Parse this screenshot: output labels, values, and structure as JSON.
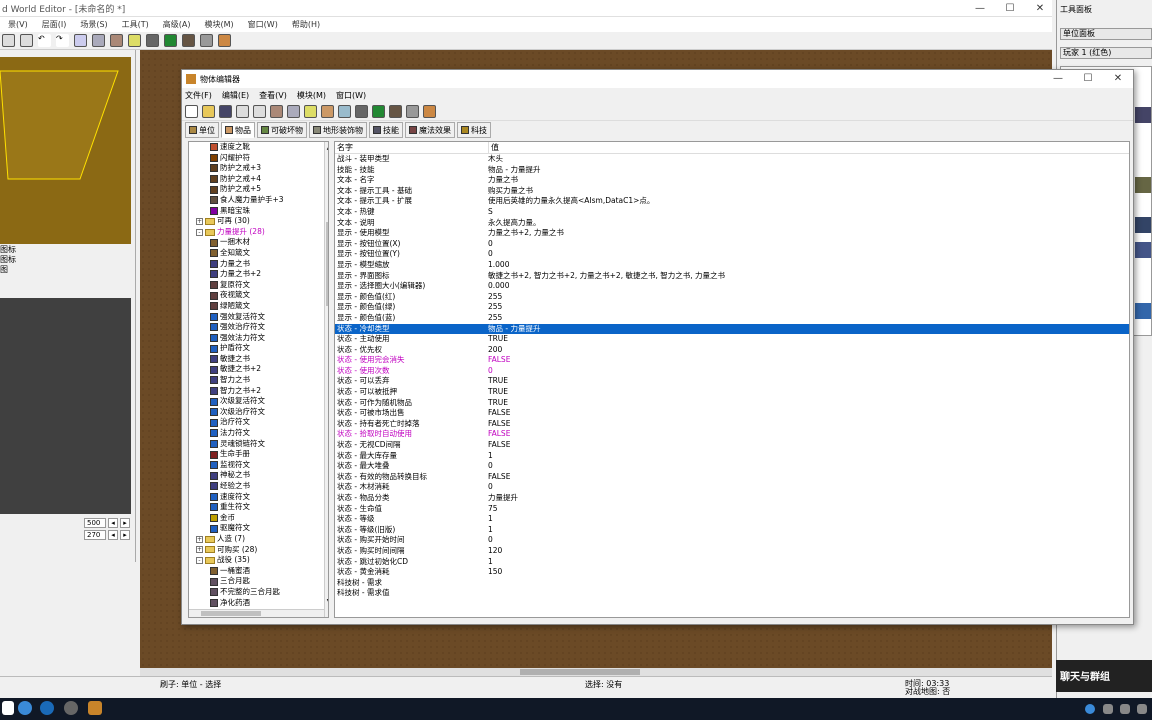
{
  "we": {
    "title": "d World Editor - [未命名的 *]",
    "menu": [
      "景(V)",
      "层面(I)",
      "场景(S)",
      "工具(T)",
      "高级(A)",
      "模块(M)",
      "窗口(W)",
      "帮助(H)"
    ],
    "left_labels": [
      "图标",
      "图标",
      "图"
    ],
    "left_values": [
      "500",
      "270"
    ]
  },
  "right_panel": {
    "title": "工具面板",
    "sel1": "单位面板",
    "sel2": "玩家 1 (红色)",
    "chat": "聊天与群组"
  },
  "status": {
    "brush": "刷子: 单位 - 选择",
    "select": "选择: 没有",
    "time": "时间: 03:33",
    "map": "对战地图: 否"
  },
  "oe": {
    "title": "物体编辑器",
    "menu": [
      "文件(F)",
      "编辑(E)",
      "查看(V)",
      "模块(M)",
      "窗口(W)"
    ],
    "tabs": [
      "单位",
      "物品",
      "可破坏物",
      "地形装饰物",
      "技能",
      "魔法效果",
      "科技"
    ],
    "tree": [
      {
        "label": "速度之靴",
        "indent": 3,
        "color": "#c05030"
      },
      {
        "label": "闪耀护符",
        "indent": 3,
        "color": "#804000"
      },
      {
        "label": "防护之戒+3",
        "indent": 3,
        "color": "#604020"
      },
      {
        "label": "防护之戒+4",
        "indent": 3,
        "color": "#604020"
      },
      {
        "label": "防护之戒+5",
        "indent": 3,
        "color": "#604020"
      },
      {
        "label": "食人魔力量护手+3",
        "indent": 3,
        "color": "#605040"
      },
      {
        "label": "黑暗宝珠",
        "indent": 3,
        "color": "#8000a0"
      },
      {
        "label": "可再 (30)",
        "indent": 1,
        "folder": true,
        "expand": "+"
      },
      {
        "label": "力量提升 (28)",
        "indent": 1,
        "folder": true,
        "expand": "-",
        "pink": true
      },
      {
        "label": "一捆木材",
        "indent": 3,
        "color": "#806030"
      },
      {
        "label": "全知箴文",
        "indent": 3,
        "color": "#806030"
      },
      {
        "label": "力量之书",
        "indent": 3,
        "color": "#404080"
      },
      {
        "label": "力量之书+2",
        "indent": 3,
        "color": "#404080"
      },
      {
        "label": "复原符文",
        "indent": 3,
        "color": "#604040"
      },
      {
        "label": "夜视箴文",
        "indent": 3,
        "color": "#604040"
      },
      {
        "label": "绿陋箴文",
        "indent": 3,
        "color": "#604040"
      },
      {
        "label": "强效复活符文",
        "indent": 3,
        "color": "#2060c0"
      },
      {
        "label": "强效治疗符文",
        "indent": 3,
        "color": "#2060c0"
      },
      {
        "label": "强效法力符文",
        "indent": 3,
        "color": "#2060c0"
      },
      {
        "label": "护盾符文",
        "indent": 3,
        "color": "#2060c0"
      },
      {
        "label": "敏捷之书",
        "indent": 3,
        "color": "#404080"
      },
      {
        "label": "敏捷之书+2",
        "indent": 3,
        "color": "#404080"
      },
      {
        "label": "智力之书",
        "indent": 3,
        "color": "#404080"
      },
      {
        "label": "智力之书+2",
        "indent": 3,
        "color": "#404080"
      },
      {
        "label": "次级复活符文",
        "indent": 3,
        "color": "#2060c0"
      },
      {
        "label": "次级治疗符文",
        "indent": 3,
        "color": "#2060c0"
      },
      {
        "label": "治疗符文",
        "indent": 3,
        "color": "#2060c0"
      },
      {
        "label": "法力符文",
        "indent": 3,
        "color": "#2060c0"
      },
      {
        "label": "灵魂锁链符文",
        "indent": 3,
        "color": "#2060c0"
      },
      {
        "label": "生命手册",
        "indent": 3,
        "color": "#802020"
      },
      {
        "label": "监视符文",
        "indent": 3,
        "color": "#2060c0"
      },
      {
        "label": "神秘之书",
        "indent": 3,
        "color": "#404080"
      },
      {
        "label": "经验之书",
        "indent": 3,
        "color": "#404080"
      },
      {
        "label": "速度符文",
        "indent": 3,
        "color": "#2060c0"
      },
      {
        "label": "重生符文",
        "indent": 3,
        "color": "#2060c0"
      },
      {
        "label": "金币",
        "indent": 3,
        "color": "#c0a000"
      },
      {
        "label": "驱魔符文",
        "indent": 3,
        "color": "#2060c0"
      },
      {
        "label": "人造 (7)",
        "indent": 1,
        "folder": true,
        "expand": "+"
      },
      {
        "label": "可购买 (28)",
        "indent": 1,
        "folder": true,
        "expand": "+"
      },
      {
        "label": "战役 (35)",
        "indent": 1,
        "folder": true,
        "expand": "-"
      },
      {
        "label": "一桶蜜酒",
        "indent": 3,
        "color": "#806030"
      },
      {
        "label": "三合月匙",
        "indent": 3,
        "color": "#605060"
      },
      {
        "label": "不完整的三合月匙",
        "indent": 3,
        "color": "#605060"
      },
      {
        "label": "净化药酒",
        "indent": 3,
        "color": "#605060"
      }
    ],
    "props_header": {
      "name": "名字",
      "value": "值"
    },
    "props": [
      {
        "k": "战斗 - 装甲类型",
        "v": "木头"
      },
      {
        "k": "技能 - 技能",
        "v": "物品 - 力量提升"
      },
      {
        "k": "文本 - 名字",
        "v": "力量之书"
      },
      {
        "k": "文本 - 提示工具 - 基础",
        "v": "购买力量之书"
      },
      {
        "k": "文本 - 提示工具 - 扩展",
        "v": "使用后英雄的力量永久提高<AIsm,DataC1>点。"
      },
      {
        "k": "文本 - 热键",
        "v": "S"
      },
      {
        "k": "文本 - 说明",
        "v": "永久提高力量。"
      },
      {
        "k": "显示 - 使用模型",
        "v": "力量之书+2, 力量之书"
      },
      {
        "k": "显示 - 按钮位置(X)",
        "v": "0"
      },
      {
        "k": "显示 - 按钮位置(Y)",
        "v": "0"
      },
      {
        "k": "显示 - 模型缩放",
        "v": "1.000"
      },
      {
        "k": "显示 - 界面图标",
        "v": "敏捷之书+2, 智力之书+2, 力量之书+2, 敏捷之书, 智力之书, 力量之书"
      },
      {
        "k": "显示 - 选择圈大小(编辑器)",
        "v": "0.000"
      },
      {
        "k": "显示 - 颜色值(红)",
        "v": "255"
      },
      {
        "k": "显示 - 颜色值(绿)",
        "v": "255"
      },
      {
        "k": "显示 - 颜色值(蓝)",
        "v": "255"
      },
      {
        "k": "状态 - 冷却类型",
        "v": "物品 - 力量提升",
        "sel": true
      },
      {
        "k": "状态 - 主动使用",
        "v": "TRUE"
      },
      {
        "k": "状态 - 优先权",
        "v": "200"
      },
      {
        "k": "状态 - 使用完会消失",
        "v": "FALSE",
        "mod": true
      },
      {
        "k": "状态 - 使用次数",
        "v": "0",
        "mod": true
      },
      {
        "k": "状态 - 可以丢弃",
        "v": "TRUE"
      },
      {
        "k": "状态 - 可以被抵押",
        "v": "TRUE"
      },
      {
        "k": "状态 - 可作为随机物品",
        "v": "TRUE"
      },
      {
        "k": "状态 - 可被市场出售",
        "v": "FALSE"
      },
      {
        "k": "状态 - 持有者死亡时掉落",
        "v": "FALSE"
      },
      {
        "k": "状态 - 拾取时自动使用",
        "v": "FALSE",
        "mod": true
      },
      {
        "k": "状态 - 无视CD间隔",
        "v": "FALSE"
      },
      {
        "k": "状态 - 最大库存量",
        "v": "1"
      },
      {
        "k": "状态 - 最大堆叠",
        "v": "0"
      },
      {
        "k": "状态 - 有效的物品转换目标",
        "v": "FALSE"
      },
      {
        "k": "状态 - 木材消耗",
        "v": "0"
      },
      {
        "k": "状态 - 物品分类",
        "v": "力量提升"
      },
      {
        "k": "状态 - 生命值",
        "v": "75"
      },
      {
        "k": "状态 - 等级",
        "v": "1"
      },
      {
        "k": "状态 - 等级(旧版)",
        "v": "1"
      },
      {
        "k": "状态 - 购买开始时间",
        "v": "0"
      },
      {
        "k": "状态 - 购买时间间隔",
        "v": "120"
      },
      {
        "k": "状态 - 跳过初始化CD",
        "v": "1"
      },
      {
        "k": "状态 - 黄金消耗",
        "v": "150"
      },
      {
        "k": "科技树 - 需求",
        "v": ""
      },
      {
        "k": "科技树 - 需求值",
        "v": ""
      }
    ]
  }
}
